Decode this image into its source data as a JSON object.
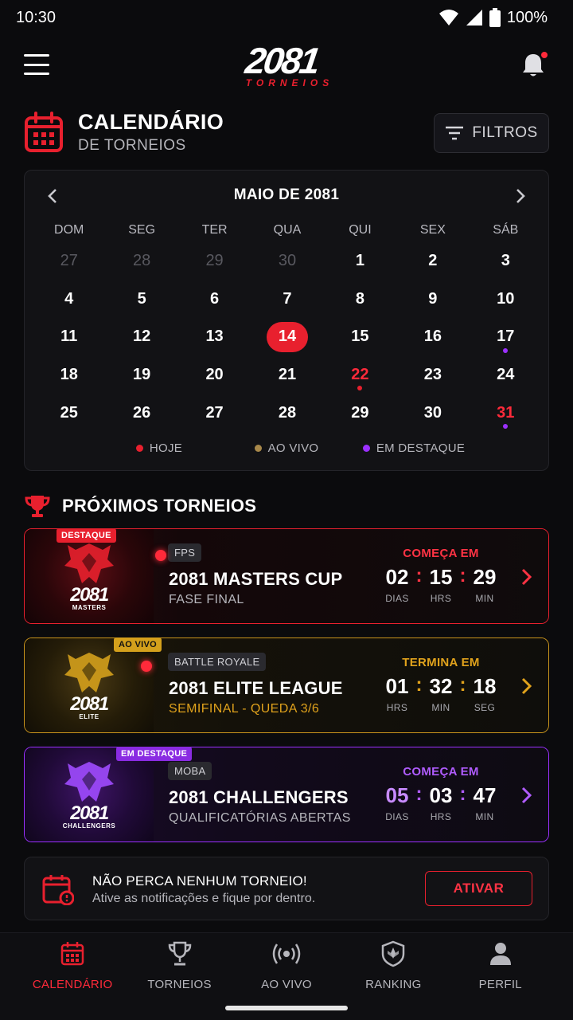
{
  "status_bar": {
    "time": "10:30",
    "battery": "100%"
  },
  "header": {
    "logo_main": "2081",
    "logo_sub": "TORNEIOS"
  },
  "page": {
    "title": "CALENDÁRIO",
    "subtitle": "DE TORNEIOS",
    "filter_label": "FILTROS"
  },
  "calendar": {
    "month_label": "MAIO DE 2081",
    "weekdays": [
      "DOM",
      "SEG",
      "TER",
      "QUA",
      "QUI",
      "SEX",
      "SÁB"
    ],
    "days": [
      {
        "d": "27",
        "muted": true
      },
      {
        "d": "28",
        "muted": true
      },
      {
        "d": "29",
        "muted": true
      },
      {
        "d": "30",
        "muted": true
      },
      {
        "d": "1"
      },
      {
        "d": "2"
      },
      {
        "d": "3"
      },
      {
        "d": "4"
      },
      {
        "d": "5"
      },
      {
        "d": "6"
      },
      {
        "d": "7"
      },
      {
        "d": "8"
      },
      {
        "d": "9"
      },
      {
        "d": "10"
      },
      {
        "d": "11"
      },
      {
        "d": "12"
      },
      {
        "d": "13"
      },
      {
        "d": "14",
        "today": true
      },
      {
        "d": "15"
      },
      {
        "d": "16"
      },
      {
        "d": "17",
        "dot": "featured"
      },
      {
        "d": "18"
      },
      {
        "d": "19"
      },
      {
        "d": "20"
      },
      {
        "d": "21"
      },
      {
        "d": "22",
        "red": true,
        "dot": "today"
      },
      {
        "d": "23"
      },
      {
        "d": "24"
      },
      {
        "d": "25"
      },
      {
        "d": "26"
      },
      {
        "d": "27"
      },
      {
        "d": "28"
      },
      {
        "d": "29"
      },
      {
        "d": "30"
      },
      {
        "d": "31",
        "red": true,
        "dot": "featured"
      }
    ],
    "legend": [
      {
        "label": "HOJE",
        "color": "#e8202e"
      },
      {
        "label": "AO VIVO",
        "color": "#a8884a"
      },
      {
        "label": "EM DESTAQUE",
        "color": "#9b30ff"
      }
    ]
  },
  "section": {
    "title": "PRÓXIMOS TORNEIOS"
  },
  "tournaments": [
    {
      "badge": "DESTAQUE",
      "genre": "FPS",
      "name": "2081 MASTERS CUP",
      "subtitle": "FASE FINAL",
      "logo_main": "2081",
      "logo_sub": "MASTERS",
      "timer_label": "COMEÇA EM",
      "units": [
        {
          "v": "02",
          "u": "DIAS"
        },
        {
          "v": "15",
          "u": "HRS"
        },
        {
          "v": "29",
          "u": "MIN"
        }
      ],
      "accent": "#e8202e"
    },
    {
      "badge": "AO VIVO",
      "genre": "BATTLE ROYALE",
      "name": "2081 ELITE LEAGUE",
      "subtitle": "SEMIFINAL - QUEDA 3/6",
      "logo_main": "2081",
      "logo_sub": "ELITE",
      "timer_label": "TERMINA EM",
      "units": [
        {
          "v": "01",
          "u": "HRS"
        },
        {
          "v": "32",
          "u": "MIN"
        },
        {
          "v": "18",
          "u": "SEG"
        }
      ],
      "accent": "#e0a21c"
    },
    {
      "badge": "EM DESTAQUE",
      "genre": "MOBA",
      "name": "2081 CHALLENGERS",
      "subtitle": "QUALIFICATÓRIAS ABERTAS",
      "logo_main": "2081",
      "logo_sub": "CHALLENGERS",
      "timer_label": "COMEÇA EM",
      "units": [
        {
          "v": "05",
          "u": "DIAS"
        },
        {
          "v": "03",
          "u": "HRS"
        },
        {
          "v": "47",
          "u": "MIN"
        }
      ],
      "accent": "#9b30ff"
    }
  ],
  "notification": {
    "title": "NÃO PERCA NENHUM TORNEIO!",
    "text": "Ative as notificações e fique por dentro.",
    "button": "ATIVAR"
  },
  "bottom_nav": [
    {
      "label": "CALENDÁRIO",
      "icon": "calendar-icon",
      "active": true
    },
    {
      "label": "TORNEIOS",
      "icon": "trophy-icon"
    },
    {
      "label": "AO VIVO",
      "icon": "live-icon"
    },
    {
      "label": "RANKING",
      "icon": "ranking-icon"
    },
    {
      "label": "PERFIL",
      "icon": "profile-icon"
    }
  ],
  "colors": {
    "accent_red": "#e8202e",
    "accent_gold": "#e0a21c",
    "accent_purple": "#9b30ff",
    "background": "#0b0b0d"
  }
}
